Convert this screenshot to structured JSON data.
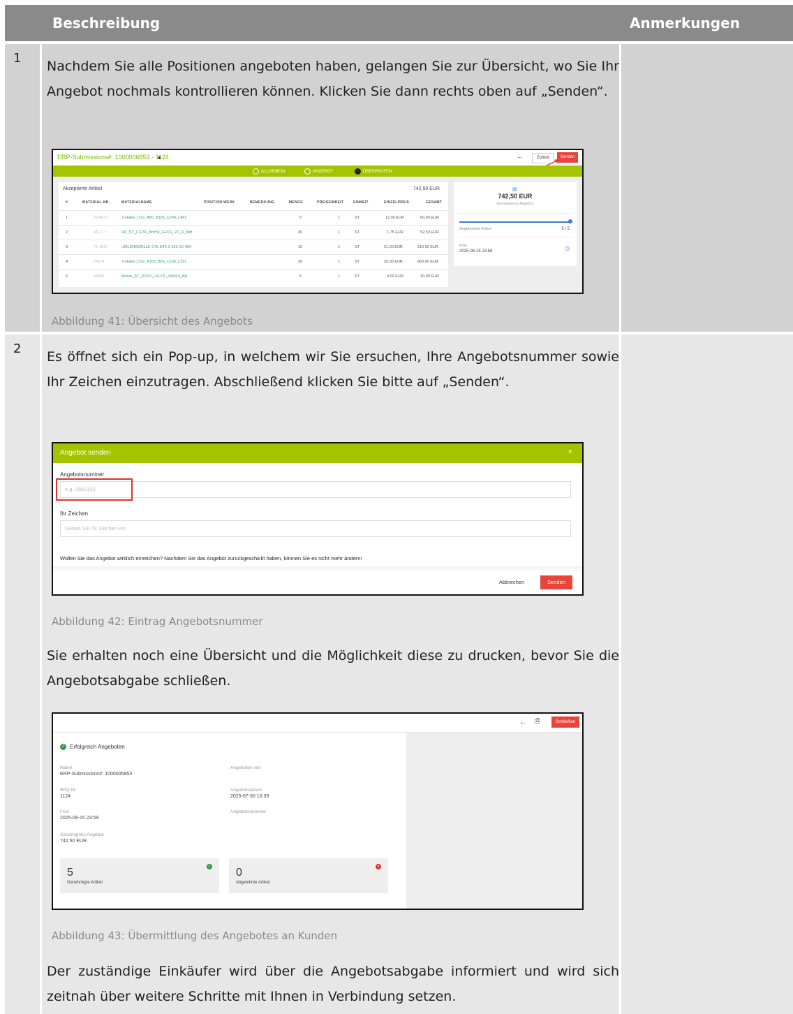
{
  "header": {
    "col_description": "Beschreibung",
    "col_remarks": "Anmerkungen"
  },
  "row1": {
    "number": "1",
    "text": "Nachdem Sie alle Positionen angeboten haben, gelangen Sie zur Übersicht, wo Sie Ihr Angebot nochmals kontrollieren können. Klicken Sie dann rechts oben auf „Senden“.",
    "caption": "Abbildung 41: Übersicht des Angebots"
  },
  "row2": {
    "number": "2",
    "text1": "Es öffnet sich ein Pop-up, in welchem wir Sie ersuchen, Ihre Angebotsnummer sowie Ihr Zeichen einzutragen. Abschließend klicken Sie bitte auf „Senden“.",
    "caption1": "Abbildung 42: Eintrag Angebotsnummer",
    "text2": "Sie erhalten noch eine Übersicht und die Möglichkeit diese zu drucken, bevor Sie die Angebotsabgabe schließen.",
    "caption2": "Abbildung 43: Übermittlung des Angebotes an Kunden",
    "text3": "Der zuständige Einkäufer wird über die Angebotsabgabe informiert und wird sich zeitnah über weitere Schritte mit Ihnen in Verbindung setzen."
  },
  "shot1": {
    "title": "ERP-Submissions#: 1000006853 - 1124",
    "back_label": "Zurück",
    "send_label": "Senden",
    "steps": [
      "ALLGEMEIN",
      "ANGEBOT",
      "ÜBERPRÜFEN"
    ],
    "panel_title": "Akzeptierte Artikel",
    "panel_total": "742,50 EUR",
    "columns": [
      "#",
      "MATERIAL-NR.",
      "MATERIALNAME",
      "POSITION WERK",
      "BEMERKUNG",
      "MENGE",
      "PREISEINHEIT",
      "EINHEIT",
      "EINZELPREIS",
      "GESAMT"
    ],
    "rows": [
      {
        "n": "1",
        "mat": "70-4622",
        "name": "Z-Halter_D12_A80_B195_C240_L481",
        "qty": "5",
        "pe": "1",
        "unit": "ST",
        "price": "12,00 EUR",
        "total": "60,00 EUR"
      },
      {
        "n": "2",
        "mat": "48-17 7",
        "name": "RP_ST_L1230_AntrSt_GFKS_VZ_R_Mitt",
        "qty": "30",
        "pe": "1",
        "unit": "ST",
        "price": "1,75 EUR",
        "total": "52,50 EUR"
      },
      {
        "n": "3",
        "mat": "71-4622",
        "name": "UMLENKWELLE C45 D45 X 622 SV 600",
        "qty": "10",
        "pe": "1",
        "unit": "ST",
        "price": "21,00 EUR",
        "total": "210,00 EUR"
      },
      {
        "n": "4",
        "mat": "74674",
        "name": "Z-Halter_D12_A100_B65_C160_L291",
        "qty": "20",
        "pe": "1",
        "unit": "ST",
        "price": "20,00 EUR",
        "total": "400,00 EUR"
      },
      {
        "n": "5",
        "mat": "43458",
        "name": "Achse_ST_D10I7_L612,5_2xM4 6_BK",
        "qty": "5",
        "pe": "1",
        "unit": "ST",
        "price": "4,00 EUR",
        "total": "20,00 EUR"
      }
    ],
    "side_total": "742,50 EUR",
    "side_total_label": "Gesamtpreis Angebot",
    "offered_label": "Angebotene Artikel",
    "offered_value": "5 / 5",
    "deadline_label": "Frist",
    "deadline_value": "2025-08-15 23:59"
  },
  "shot2": {
    "title": "Angebot senden",
    "close": "×",
    "offer_label": "Angebotsnummer",
    "offer_placeholder": "e.g. 2983102",
    "sign_label": "Ihr Zeichen",
    "sign_placeholder": "Geben Sie Ihr Zeichen ein",
    "confirm_text": "Wollen Sie das Angebot wirklich einreichen? Nachdem Sie das Angebot zurückgeschickt haben, können Sie es nicht mehr ändern!",
    "cancel_label": "Abbrechen",
    "send_label": "Senden"
  },
  "shot3": {
    "close_label": "Schließen",
    "success_label": "Erfolgreich Angeboten",
    "name_label": "Name",
    "name_value": "ERP-Submissions#: 1000006853",
    "rfq_label": "RFQ Nr.",
    "rfq_value": "1124",
    "deadline_label": "Frist",
    "deadline_value": "2025-08-15 23:59",
    "total_label": "Gesamtpreis Angebot",
    "total_value": "742,50 EUR",
    "offered_by_label": "Angeboten von",
    "date_label": "Angebotsdatum",
    "date_value": "2025-07-30 10:39",
    "offer_no_label": "Angebotsnummer",
    "approved_count": "5",
    "approved_label": "Genehmigte Artikel",
    "rejected_count": "0",
    "rejected_label": "Abgelehnte Artikel"
  },
  "colors": {
    "green": "#a5c400",
    "red": "#e8443a",
    "header_grey": "#8a8a8a"
  }
}
